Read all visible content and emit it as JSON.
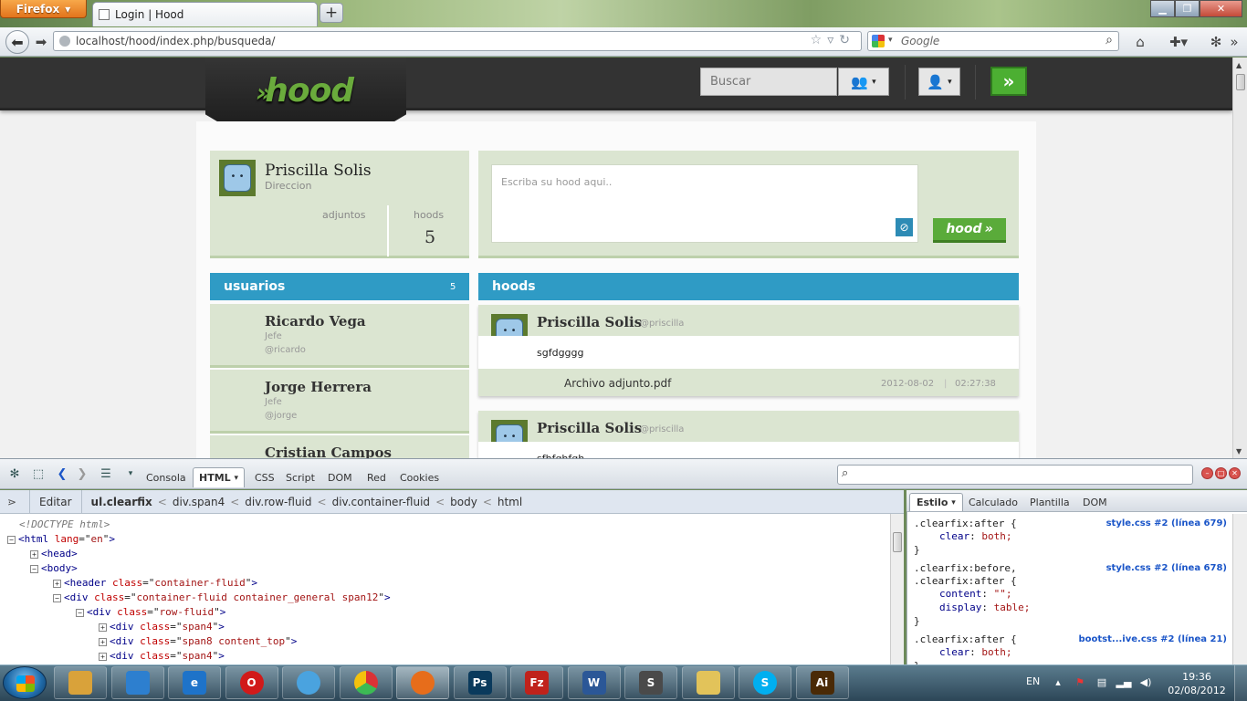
{
  "browser": {
    "app_button": "Firefox",
    "tab_title": "Login | Hood",
    "new_tab": "+",
    "url": "localhost/hood/index.php/busqueda/",
    "search_placeholder": "Google"
  },
  "site": {
    "logo": "hood",
    "search_placeholder": "Buscar",
    "accent_green": "#4caf32",
    "accent_blue": "#2f9bc5"
  },
  "profile": {
    "name": "Priscilla Solis",
    "subtitle": "Direccion",
    "attachments_label": "adjuntos",
    "hoods_label": "hoods",
    "hoods_count": "5"
  },
  "composer": {
    "placeholder": "Escriba su hood aqui..",
    "submit_label": "hood"
  },
  "users": {
    "title": "usuarios",
    "count": "5",
    "items": [
      {
        "name": "Ricardo Vega",
        "role": "Jefe",
        "handle": "@ricardo"
      },
      {
        "name": "Jorge Herrera",
        "role": "Jefe",
        "handle": "@jorge"
      },
      {
        "name": "Cristian Campos",
        "role": "",
        "handle": ""
      }
    ]
  },
  "hoods": {
    "title": "hoods",
    "items": [
      {
        "author": "Priscilla Solis",
        "handle": "@priscilla",
        "text": "sgfdgggg",
        "attachment": "Archivo adjunto.pdf",
        "date": "2012-08-02",
        "time": "02:27:38"
      },
      {
        "author": "Priscilla Solis",
        "handle": "@priscilla",
        "text": "sfhfghfgh",
        "attachment": "",
        "date": "",
        "time": ""
      }
    ]
  },
  "firebug": {
    "tabs": [
      "Consola",
      "HTML",
      "CSS",
      "Script",
      "DOM",
      "Red",
      "Cookies"
    ],
    "active_tab": "HTML",
    "edit_label": "Editar",
    "breadcrumbs": [
      "ul.clearfix",
      "div.span4",
      "div.row-fluid",
      "div.container-fluid",
      "body",
      "html"
    ],
    "tree": [
      {
        "indent": 0,
        "toggle": "",
        "tag": "",
        "comment": "<!DOCTYPE html>"
      },
      {
        "indent": 0,
        "toggle": "-",
        "tag": "html",
        "attr": "lang",
        "value": "en"
      },
      {
        "indent": 1,
        "toggle": "+",
        "tag": "head"
      },
      {
        "indent": 1,
        "toggle": "-",
        "tag": "body"
      },
      {
        "indent": 2,
        "toggle": "+",
        "tag": "header",
        "attr": "class",
        "value": "container-fluid"
      },
      {
        "indent": 2,
        "toggle": "-",
        "tag": "div",
        "attr": "class",
        "value": "container-fluid container_general span12"
      },
      {
        "indent": 3,
        "toggle": "-",
        "tag": "div",
        "attr": "class",
        "value": "row-fluid"
      },
      {
        "indent": 4,
        "toggle": "+",
        "tag": "div",
        "attr": "class",
        "value": "span4"
      },
      {
        "indent": 4,
        "toggle": "+",
        "tag": "div",
        "attr": "class",
        "value": "span8 content_top"
      },
      {
        "indent": 4,
        "toggle": "+",
        "tag": "div",
        "attr": "class",
        "value": "span4"
      }
    ],
    "side_tabs": [
      "Estilo",
      "Calculado",
      "Plantilla",
      "DOM"
    ],
    "css_rules": [
      {
        "selectors": [
          ".clearfix:after {"
        ],
        "props": [
          [
            "clear",
            "both;"
          ]
        ],
        "source": "style.css #2 (línea 679)"
      },
      {
        "selectors": [
          ".clearfix:before,",
          ".clearfix:after {"
        ],
        "props": [
          [
            "content",
            "\"\";"
          ],
          [
            "display",
            "table;"
          ]
        ],
        "source": "style.css #2 (línea 678)"
      },
      {
        "selectors": [
          ".clearfix:after {"
        ],
        "props": [
          [
            "clear",
            "both;"
          ]
        ],
        "source": "bootst...ive.css #2 (línea 21)"
      }
    ]
  },
  "taskbar": {
    "apps": [
      {
        "icon": "explorer-icon",
        "label": "",
        "color": "#d9a23a"
      },
      {
        "icon": "media-player-icon",
        "label": "",
        "color": "#2d7fcf"
      },
      {
        "icon": "ie-icon",
        "label": "e",
        "color": "#1e73c9"
      },
      {
        "icon": "opera-icon",
        "label": "O",
        "color": "#d11a1a"
      },
      {
        "icon": "safari-icon",
        "label": "",
        "color": "#4aa3df"
      },
      {
        "icon": "chrome-icon",
        "label": "",
        "color": "#3aa755"
      },
      {
        "icon": "firefox-icon",
        "label": "",
        "color": "#e76d1b"
      },
      {
        "icon": "photoshop-icon",
        "label": "Ps",
        "color": "#0a3a5c"
      },
      {
        "icon": "filezilla-icon",
        "label": "Fz",
        "color": "#c0221b"
      },
      {
        "icon": "word-icon",
        "label": "W",
        "color": "#2b5797"
      },
      {
        "icon": "sublime-icon",
        "label": "S",
        "color": "#4a4a4a"
      },
      {
        "icon": "folders-icon",
        "label": "",
        "color": "#e2c35a"
      },
      {
        "icon": "skype-icon",
        "label": "S",
        "color": "#00aff0"
      },
      {
        "icon": "illustrator-icon",
        "label": "Ai",
        "color": "#4a2a06"
      }
    ],
    "language": "EN",
    "time": "19:36",
    "date": "02/08/2012"
  }
}
